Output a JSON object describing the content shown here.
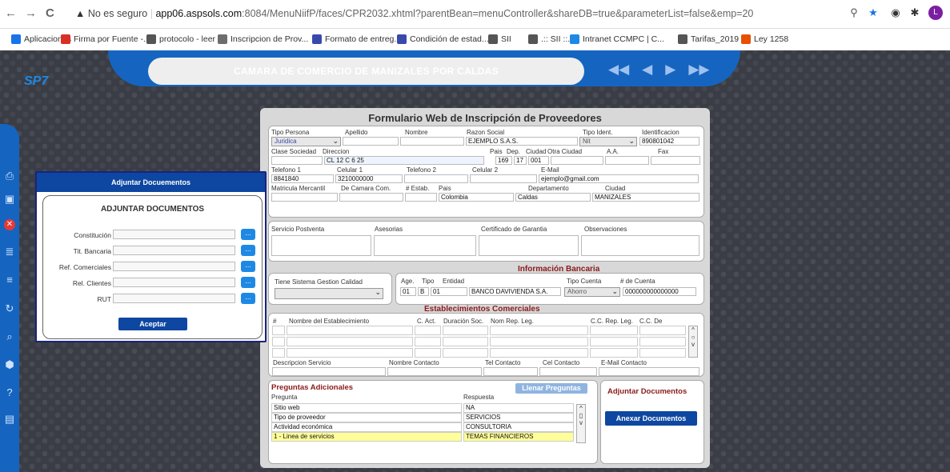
{
  "browser": {
    "back": "←",
    "forward": "→",
    "reload": "C",
    "security_icon": "warning-icon",
    "security_text": "No es seguro",
    "url_host": "app06.aspsols.com",
    "url_path": ":8084/MenuNiifP/faces/CPR2032.xhtml?parentBean=menuController&shareDB=true&parameterList=false&emp=20",
    "right_icons": [
      "zoom-icon",
      "star-icon",
      "extension-icon",
      "puzzle-icon",
      "profile-icon"
    ],
    "profile_initial": "L"
  },
  "bookmarks": [
    {
      "label": "Aplicaciones",
      "icon": "apps-icon",
      "color": "#1a73e8"
    },
    {
      "label": "Firma por Fuente -...",
      "icon": "gmail-icon",
      "color": "#d93025"
    },
    {
      "label": "protocolo - leer",
      "icon": "globe-icon",
      "color": "#555555"
    },
    {
      "label": "Inscripcion de Prov...",
      "icon": "doc-icon",
      "color": "#6d6d6d"
    },
    {
      "label": "Formato de entreg...",
      "icon": "sheet-icon",
      "color": "#3949ab"
    },
    {
      "label": "Condición de estad...",
      "icon": "sheet-icon",
      "color": "#3949ab"
    },
    {
      "label": "SII",
      "icon": "globe-icon",
      "color": "#555555"
    },
    {
      "label": ".:: SII ::.",
      "icon": "sii-icon",
      "color": "#555555"
    },
    {
      "label": "Intranet CCMPC | C...",
      "icon": "intranet-icon",
      "color": "#1e88e5"
    },
    {
      "label": "Tarifas_2019",
      "icon": "globe-icon",
      "color": "#555555"
    },
    {
      "label": "Ley 1258",
      "icon": "ley-icon",
      "color": "#e65100"
    }
  ],
  "app": {
    "header_title": "CAMARA DE COMERCIO DE MANIZALES POR CALDAS",
    "logo_text": "SP",
    "logo_suffix": "7",
    "nav_arrows": [
      "◀◀",
      "◀",
      "▶",
      "▶▶"
    ]
  },
  "sidebar_icons": [
    "print-icon",
    "save-icon",
    "cancel-icon",
    "db-add-icon",
    "db-icon",
    "refresh-icon",
    "search-doc-icon",
    "settings-icon",
    "help-icon",
    "excel-icon"
  ],
  "form": {
    "title": "Formulario Web de Inscripción de Proveedores",
    "labels": {
      "tipo_persona": "Tipo Persona",
      "apellido": "Apellido",
      "nombre": "Nombre",
      "razon_social": "Razon Social",
      "tipo_ident": "Tipo Ident.",
      "identificacion": "Identificacion",
      "clase_sociedad": "Clase Sociedad",
      "direccion": "Direccion",
      "pais": "Pais",
      "dep": "Dep.",
      "ciudad": "Ciudad",
      "otra_ciudad": "Otra Ciudad",
      "aa": "A.A.",
      "fax": "Fax",
      "telefono1": "Telefono 1",
      "celular1": "Celular 1",
      "telefono2": "Telefono 2",
      "celular2": "Celular 2",
      "email": "E-Mail",
      "matricula": "Matricula Mercantil",
      "de_camara": "De Camara Com.",
      "num_estab": "# Estab.",
      "pais2": "Pais",
      "departamento": "Departamento",
      "ciudad2": "Ciudad"
    },
    "values": {
      "tipo_persona": "Juridica",
      "razon_social": "EJEMPLO S.A.S.",
      "tipo_ident": "Nit",
      "identificacion": "890801042",
      "direccion": "CL 12 C 6 25",
      "pais": "169",
      "dep": "17",
      "ciudad": "001",
      "telefono1": "8841840",
      "celular1": "3210000000",
      "email": "ejemplo@gmail.com",
      "pais2": "Colombia",
      "departamento": "Caldas",
      "ciudad2": "MANIZALES"
    },
    "services": {
      "servicio_postventa": "Servicio Postventa",
      "asesorias": "Asesorias",
      "certificado": "Certificado de Garantia",
      "observaciones": "Observaciones"
    },
    "bank": {
      "section_title": "Información Bancaria",
      "calidad_label": "Tiene Sistema Gestion Calidad",
      "age_label": "Age.",
      "tipo_label": "Tipo",
      "entidad_label": "Entidad",
      "tipo_cuenta_label": "Tipo Cuenta",
      "num_cuenta_label": "# de Cuenta",
      "age": "01",
      "tipo": "B",
      "entidad_code": "01",
      "entidad": "BANCO DAVIVIENDA S.A.",
      "tipo_cuenta": "Ahorro",
      "num_cuenta": "000000000000000"
    },
    "establishments": {
      "section_title": "Establecimientos Comerciales",
      "headers": [
        "#",
        "Nombre del Establecimiento",
        "C. Act.",
        "Duración Soc.",
        "Nom Rep. Leg.",
        "C.C. Rep. Leg.",
        "C.C. De"
      ],
      "footer_labels": [
        "Descripcion Servicio",
        "Nombre Contacto",
        "Tel Contacto",
        "Cel Contacto",
        "E-Mail Contacto"
      ]
    },
    "preguntas": {
      "title": "Preguntas Adicionales",
      "fill_button": "Llenar Preguntas",
      "col_pregunta": "Pregunta",
      "col_respuesta": "Respuesta",
      "rows": [
        {
          "pregunta": "Sitio web",
          "respuesta": "NA"
        },
        {
          "pregunta": "Tipo de proveedor",
          "respuesta": "SERVICIOS"
        },
        {
          "pregunta": "Actividad económica",
          "respuesta": "CONSULTORIA"
        },
        {
          "pregunta": "1 - Linea de servicios",
          "respuesta": "TEMAS FINANCIEROS"
        }
      ]
    },
    "adjuntar": {
      "title": "Adjuntar Documentos",
      "button": "Anexar Documentos"
    }
  },
  "dialog": {
    "header": "Adjuntar Docuementos",
    "title": "ADJUNTAR DOCUMENTOS",
    "rows": [
      "Constitución",
      "Tit. Bancaria",
      "Ref. Comerciales",
      "Rel. Clientes",
      "RUT"
    ],
    "browse_label": "...",
    "accept": "Aceptar"
  }
}
